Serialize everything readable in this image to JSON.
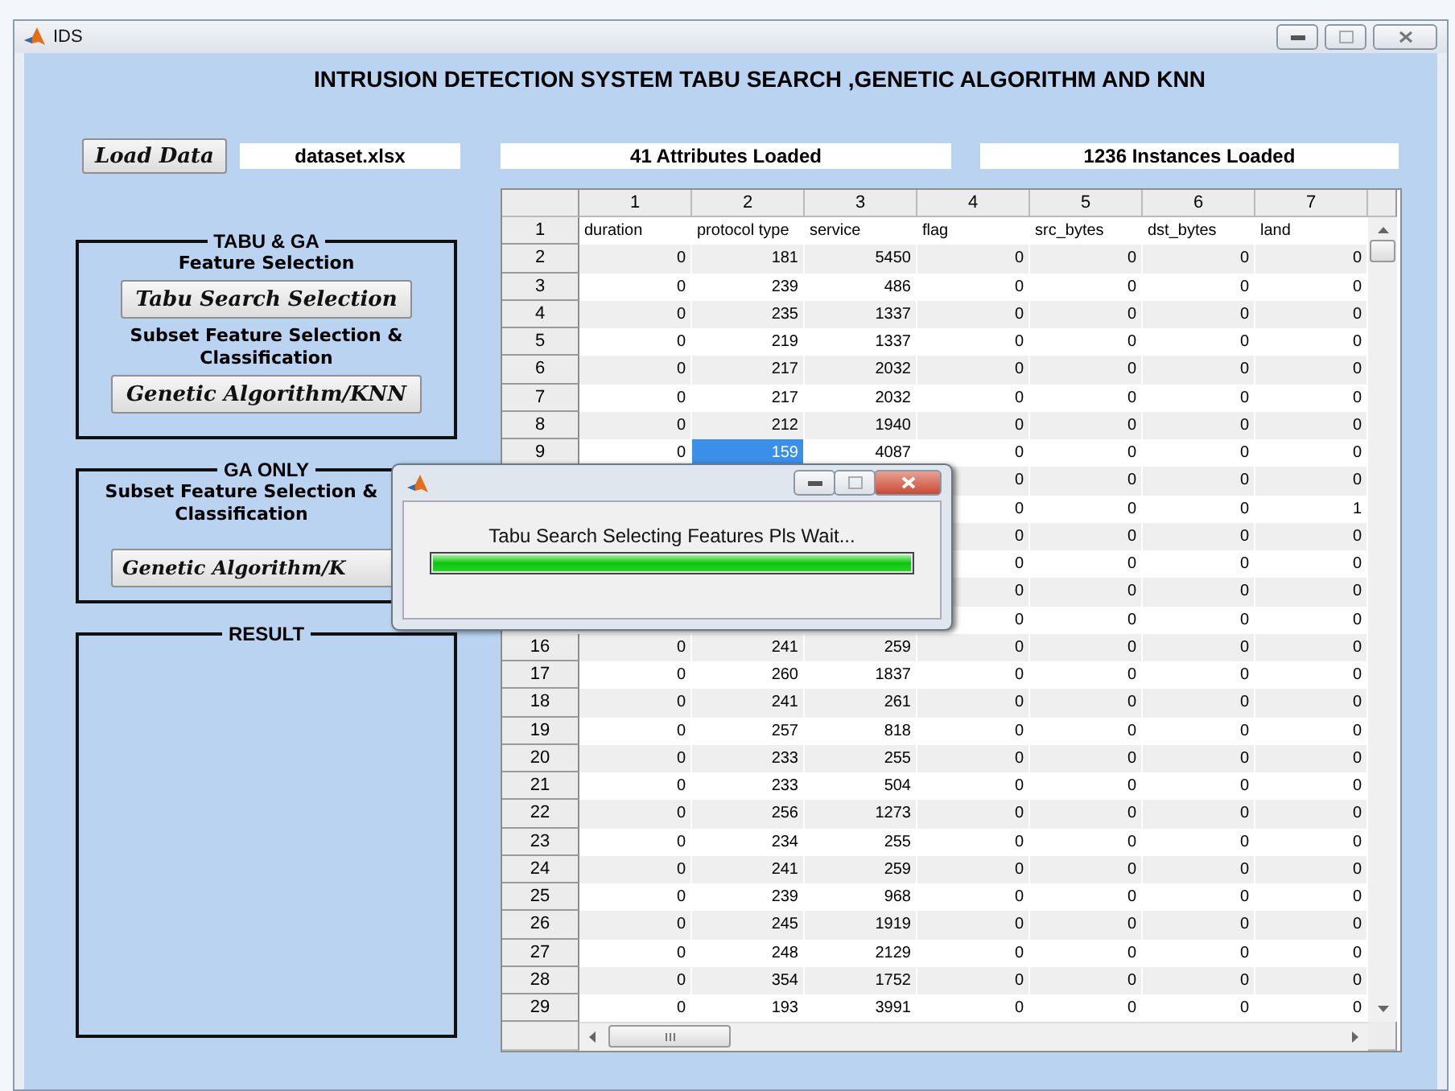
{
  "window": {
    "title": "IDS"
  },
  "heading": "INTRUSION DETECTION SYSTEM TABU SEARCH ,GENETIC ALGORITHM AND KNN",
  "load_button": "Load Data",
  "file_field": {
    "value": "dataset.xlsx"
  },
  "attributes_field": {
    "value": "41 Attributes Loaded"
  },
  "instances_field": {
    "value": "1236 Instances Loaded"
  },
  "panels": [
    {
      "title": "TABU & GA",
      "items": [
        {
          "kind": "label",
          "text": "Feature Selection"
        },
        {
          "kind": "button",
          "text": "Tabu Search Selection"
        },
        {
          "kind": "label",
          "text": "Subset Feature Selection & Classification"
        },
        {
          "kind": "button",
          "text": "Genetic Algorithm/KNN"
        }
      ]
    },
    {
      "title": "GA ONLY",
      "items": [
        {
          "kind": "label",
          "text": "Subset Feature Selection & Classification"
        },
        {
          "kind": "button",
          "text": "Genetic Algorithm/K"
        }
      ]
    },
    {
      "title": "RESULT"
    }
  ],
  "table": {
    "columns": [
      "1",
      "2",
      "3",
      "4",
      "5",
      "6",
      "7"
    ],
    "rows": [
      {
        "header": "1",
        "cells": [
          "duration",
          "protocol type",
          "service",
          "flag",
          "src_bytes",
          "dst_bytes",
          "land"
        ]
      },
      {
        "header": "2",
        "cells": [
          "0",
          "181",
          "5450",
          "0",
          "0",
          "0",
          "0"
        ]
      },
      {
        "header": "3",
        "cells": [
          "0",
          "239",
          "486",
          "0",
          "0",
          "0",
          "0"
        ]
      },
      {
        "header": "4",
        "cells": [
          "0",
          "235",
          "1337",
          "0",
          "0",
          "0",
          "0"
        ]
      },
      {
        "header": "5",
        "cells": [
          "0",
          "219",
          "1337",
          "0",
          "0",
          "0",
          "0"
        ]
      },
      {
        "header": "6",
        "cells": [
          "0",
          "217",
          "2032",
          "0",
          "0",
          "0",
          "0"
        ]
      },
      {
        "header": "7",
        "cells": [
          "0",
          "217",
          "2032",
          "0",
          "0",
          "0",
          "0"
        ]
      },
      {
        "header": "8",
        "cells": [
          "0",
          "212",
          "1940",
          "0",
          "0",
          "0",
          "0"
        ]
      },
      {
        "header": "9",
        "cells": [
          "0",
          {
            "text": "159",
            "selected": true
          },
          "4087",
          "0",
          "0",
          "0",
          "0"
        ]
      },
      {
        "header": null,
        "cells": [
          null,
          null,
          null,
          "0",
          "0",
          "0",
          "0"
        ]
      },
      {
        "header": null,
        "cells": [
          null,
          null,
          null,
          "0",
          "0",
          "0",
          "1"
        ]
      },
      {
        "header": null,
        "cells": [
          null,
          null,
          null,
          "0",
          "0",
          "0",
          "0"
        ]
      },
      {
        "header": null,
        "cells": [
          null,
          null,
          null,
          "0",
          "0",
          "0",
          "0"
        ]
      },
      {
        "header": null,
        "cells": [
          null,
          null,
          null,
          "0",
          "0",
          "0",
          "0"
        ]
      },
      {
        "header": null,
        "cells": [
          null,
          null,
          null,
          "0",
          "0",
          "0",
          "0"
        ]
      },
      {
        "header": "16",
        "cells": [
          "0",
          "241",
          "259",
          "0",
          "0",
          "0",
          "0"
        ]
      },
      {
        "header": "17",
        "cells": [
          "0",
          "260",
          "1837",
          "0",
          "0",
          "0",
          "0"
        ]
      },
      {
        "header": "18",
        "cells": [
          "0",
          "241",
          "261",
          "0",
          "0",
          "0",
          "0"
        ]
      },
      {
        "header": "19",
        "cells": [
          "0",
          "257",
          "818",
          "0",
          "0",
          "0",
          "0"
        ]
      },
      {
        "header": "20",
        "cells": [
          "0",
          "233",
          "255",
          "0",
          "0",
          "0",
          "0"
        ]
      },
      {
        "header": "21",
        "cells": [
          "0",
          "233",
          "504",
          "0",
          "0",
          "0",
          "0"
        ]
      },
      {
        "header": "22",
        "cells": [
          "0",
          "256",
          "1273",
          "0",
          "0",
          "0",
          "0"
        ]
      },
      {
        "header": "23",
        "cells": [
          "0",
          "234",
          "255",
          "0",
          "0",
          "0",
          "0"
        ]
      },
      {
        "header": "24",
        "cells": [
          "0",
          "241",
          "259",
          "0",
          "0",
          "0",
          "0"
        ]
      },
      {
        "header": "25",
        "cells": [
          "0",
          "239",
          "968",
          "0",
          "0",
          "0",
          "0"
        ]
      },
      {
        "header": "26",
        "cells": [
          "0",
          "245",
          "1919",
          "0",
          "0",
          "0",
          "0"
        ]
      },
      {
        "header": "27",
        "cells": [
          "0",
          "248",
          "2129",
          "0",
          "0",
          "0",
          "0"
        ]
      },
      {
        "header": "28",
        "cells": [
          "0",
          "354",
          "1752",
          "0",
          "0",
          "0",
          "0"
        ]
      },
      {
        "header": "29",
        "cells": [
          "0",
          "193",
          "3991",
          "0",
          "0",
          "0",
          "0"
        ]
      }
    ]
  },
  "dialog": {
    "message": "Tabu Search Selecting Features Pls Wait...",
    "progress": {
      "level": 1
    }
  }
}
